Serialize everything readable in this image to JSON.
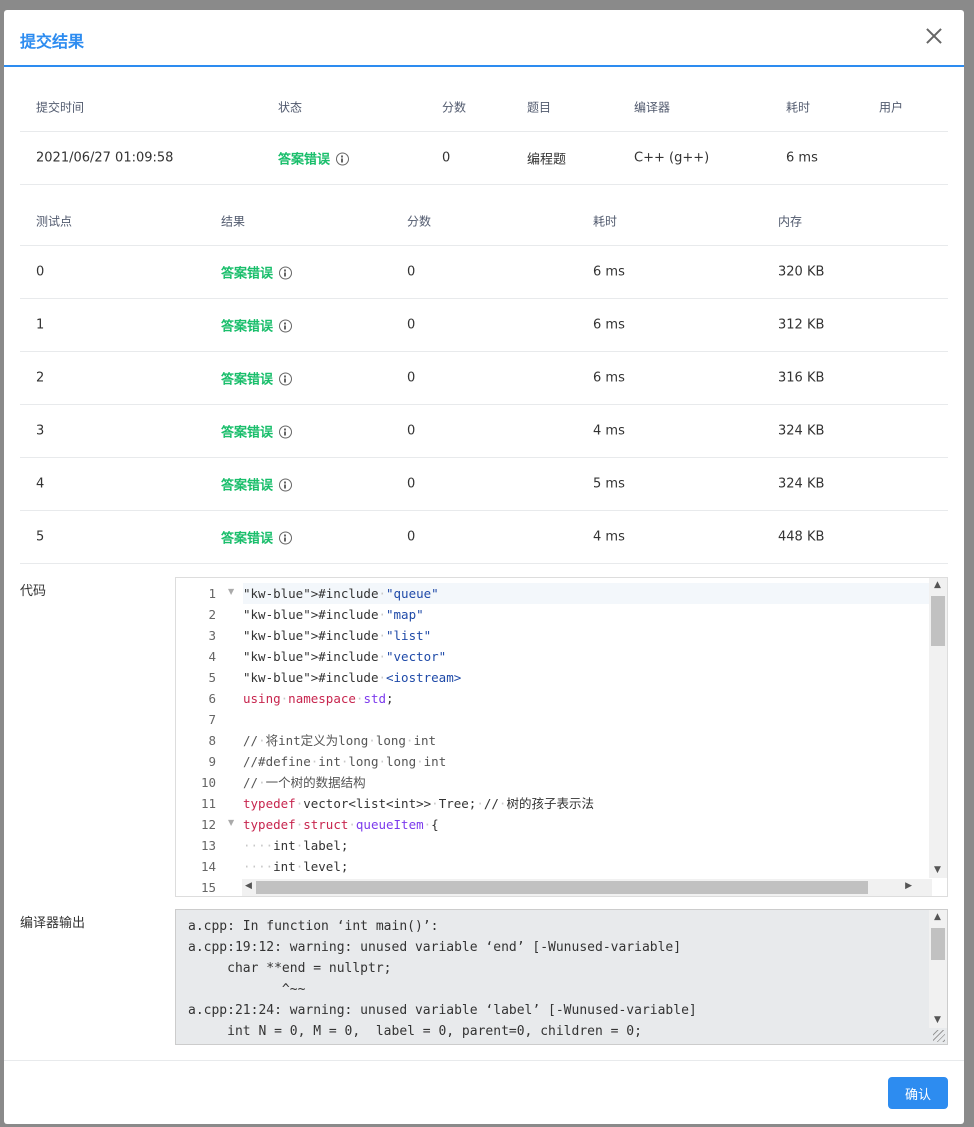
{
  "modal": {
    "title": "提交结果",
    "ok_label": "确认"
  },
  "submission": {
    "headers": [
      "提交时间",
      "状态",
      "分数",
      "题目",
      "编译器",
      "耗时",
      "用户"
    ],
    "time": "2021/06/27 01:09:58",
    "status": "答案错误",
    "score": "0",
    "problem": "编程题",
    "compiler": "C++ (g++)",
    "elapsed": "6 ms",
    "user": ""
  },
  "tests": {
    "headers": [
      "测试点",
      "结果",
      "分数",
      "耗时",
      "内存"
    ],
    "rows": [
      {
        "id": "0",
        "result": "答案错误",
        "score": "0",
        "time": "6 ms",
        "memory": "320 KB"
      },
      {
        "id": "1",
        "result": "答案错误",
        "score": "0",
        "time": "6 ms",
        "memory": "312 KB"
      },
      {
        "id": "2",
        "result": "答案错误",
        "score": "0",
        "time": "6 ms",
        "memory": "316 KB"
      },
      {
        "id": "3",
        "result": "答案错误",
        "score": "0",
        "time": "4 ms",
        "memory": "324 KB"
      },
      {
        "id": "4",
        "result": "答案错误",
        "score": "0",
        "time": "5 ms",
        "memory": "324 KB"
      },
      {
        "id": "5",
        "result": "答案错误",
        "score": "0",
        "time": "4 ms",
        "memory": "448 KB"
      }
    ]
  },
  "code": {
    "label": "代码",
    "line_numbers": [
      "1",
      "2",
      "3",
      "4",
      "5",
      "6",
      "7",
      "8",
      "9",
      "10",
      "11",
      "12",
      "13",
      "14",
      "15"
    ],
    "lines": [
      "#include·\"queue\"",
      "#include·\"map\"",
      "#include·\"list\"",
      "#include·\"vector\"",
      "#include·<iostream>",
      "using·namespace·std;",
      "",
      "//·将int定义为long·long·int",
      "//#define·int·long·long·int",
      "//·一个树的数据结构",
      "typedef·vector<list<int>>·Tree;·//·树的孩子表示法",
      "typedef·struct·queueItem·{",
      "····int·label;",
      "····int·level;",
      ""
    ]
  },
  "compiler_output": {
    "label": "编译器输出",
    "lines": [
      "a.cpp: In function ‘int main()’:",
      "a.cpp:19:12: warning: unused variable ‘end’ [-Wunused-variable]",
      "     char **end = nullptr;",
      "            ^~~",
      "a.cpp:21:24: warning: unused variable ‘label’ [-Wunused-variable]",
      "     int N = 0, M = 0,  label = 0, parent=0, children = 0;"
    ]
  }
}
